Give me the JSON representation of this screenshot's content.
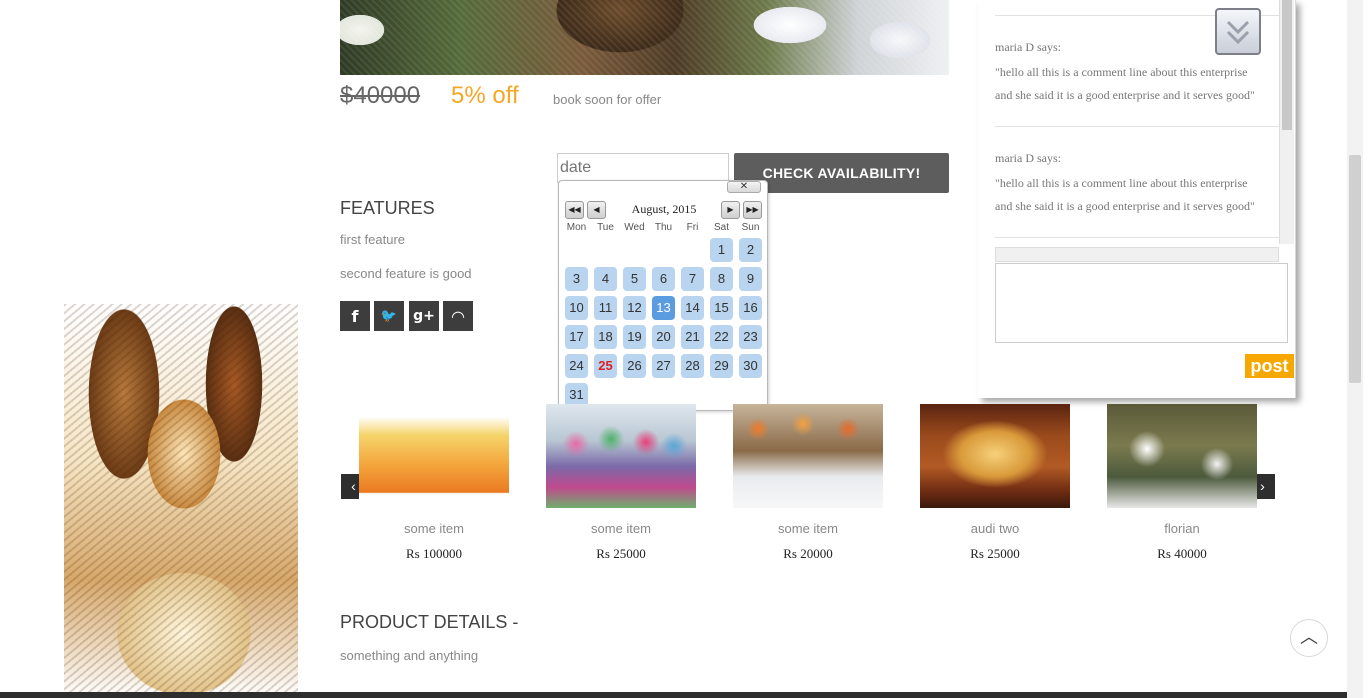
{
  "offer": {
    "old_price": "$40000",
    "discount": "5% off",
    "note": "book soon for offer"
  },
  "booking": {
    "date_placeholder": "date",
    "check_label": "CHECK AVAILABILITY!"
  },
  "features": {
    "title": "FEATURES",
    "items": [
      "first feature",
      "second feature is good"
    ]
  },
  "social": {
    "icons": [
      "facebook-icon",
      "twitter-icon",
      "google-plus-icon",
      "rss-icon"
    ],
    "glyphs": [
      "f",
      "🐦",
      "g+",
      "◠"
    ]
  },
  "calendar": {
    "title": "August, 2015",
    "close": "✕",
    "prev_year": "◀◀",
    "prev_month": "◀",
    "next_month": "▶",
    "next_year": "▶▶",
    "weekdays": [
      "Mon",
      "Tue",
      "Wed",
      "Thu",
      "Fri",
      "Sat",
      "Sun"
    ],
    "days": [
      [
        "",
        "",
        "",
        "",
        "",
        "1",
        "2"
      ],
      [
        "3",
        "4",
        "5",
        "6",
        "7",
        "8",
        "9"
      ],
      [
        "10",
        "11",
        "12",
        "13",
        "14",
        "15",
        "16"
      ],
      [
        "17",
        "18",
        "19",
        "20",
        "21",
        "22",
        "23"
      ],
      [
        "24",
        "25",
        "26",
        "27",
        "28",
        "29",
        "30"
      ],
      [
        "31",
        "",
        "",
        "",
        "",
        "",
        ""
      ]
    ],
    "today": "13",
    "holiday": "25"
  },
  "comments": [
    {
      "author": "maria D says:",
      "line1": "\"hello all this is a comment line about this enterprise",
      "line2": "and she said it is a good enterprise and it serves good\""
    },
    {
      "author": "maria D says:",
      "line1": "\"hello all this is a comment line about this enterprise",
      "line2": "and she said it is a good enterprise and it serves good\""
    }
  ],
  "comment_form": {
    "post_label": "post"
  },
  "carousel": {
    "prev": "‹",
    "next": "›",
    "items": [
      {
        "name": "some item",
        "price": "Rs 100000"
      },
      {
        "name": "some item",
        "price": "Rs 25000"
      },
      {
        "name": "some item",
        "price": "Rs 20000"
      },
      {
        "name": "audi two",
        "price": "Rs 25000"
      },
      {
        "name": "florian",
        "price": "Rs 40000"
      }
    ]
  },
  "product_details": {
    "title": "PRODUCT DETAILS -",
    "text": "something and anything"
  },
  "back_to_top": "︿"
}
